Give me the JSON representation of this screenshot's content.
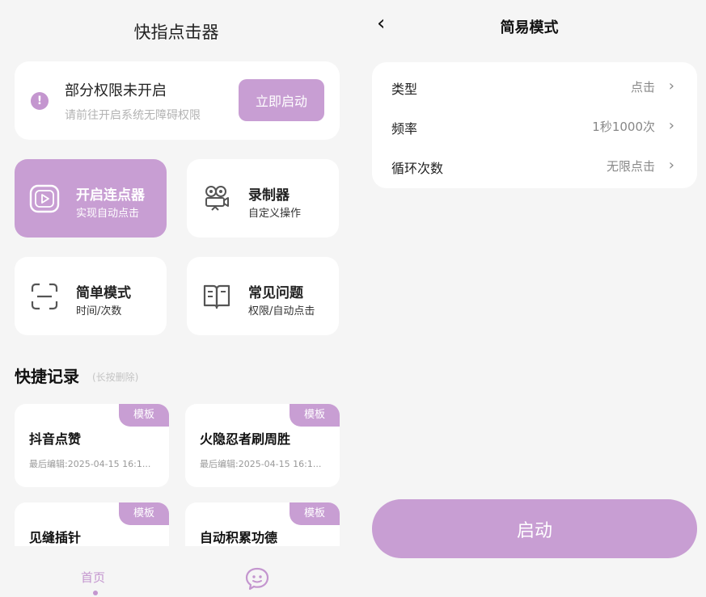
{
  "left": {
    "title": "快指点击器",
    "permission": {
      "icon": "exclamation-icon",
      "title": "部分权限未开启",
      "subtitle": "请前往开启系统无障碍权限",
      "button": "立即启动"
    },
    "features": [
      {
        "icon": "play-icon",
        "title": "开启连点器",
        "subtitle": "实现自动点击"
      },
      {
        "icon": "camera-icon",
        "title": "录制器",
        "subtitle": "自定义操作"
      },
      {
        "icon": "scan-icon",
        "title": "简单模式",
        "subtitle": "时间/次数"
      },
      {
        "icon": "book-icon",
        "title": "常见问题",
        "subtitle": "权限/自动点击"
      }
    ],
    "section_title": "快捷记录",
    "section_hint": "(长按删除)",
    "records": [
      {
        "tag": "模板",
        "title": "抖音点赞",
        "date": "最后编辑:2025-04-15 16:1..."
      },
      {
        "tag": "模板",
        "title": "火隐忍者刷周胜",
        "date": "最后编辑:2025-04-15 16:1..."
      },
      {
        "tag": "模板",
        "title": "见缝插针",
        "date": ""
      },
      {
        "tag": "模板",
        "title": "自动积累功德",
        "date": ""
      }
    ],
    "nav": {
      "home": "首页",
      "chat_icon": "chat-bubble-icon"
    }
  },
  "right": {
    "back_icon": "chevron-left-icon",
    "title": "简易模式",
    "settings": [
      {
        "label": "类型",
        "value": "点击"
      },
      {
        "label": "频率",
        "value": "1秒1000次"
      },
      {
        "label": "循环次数",
        "value": "无限点击"
      }
    ],
    "start_button": "启动"
  },
  "colors": {
    "accent": "#c89ed3",
    "background": "#f5f5f5",
    "card": "#ffffff"
  }
}
